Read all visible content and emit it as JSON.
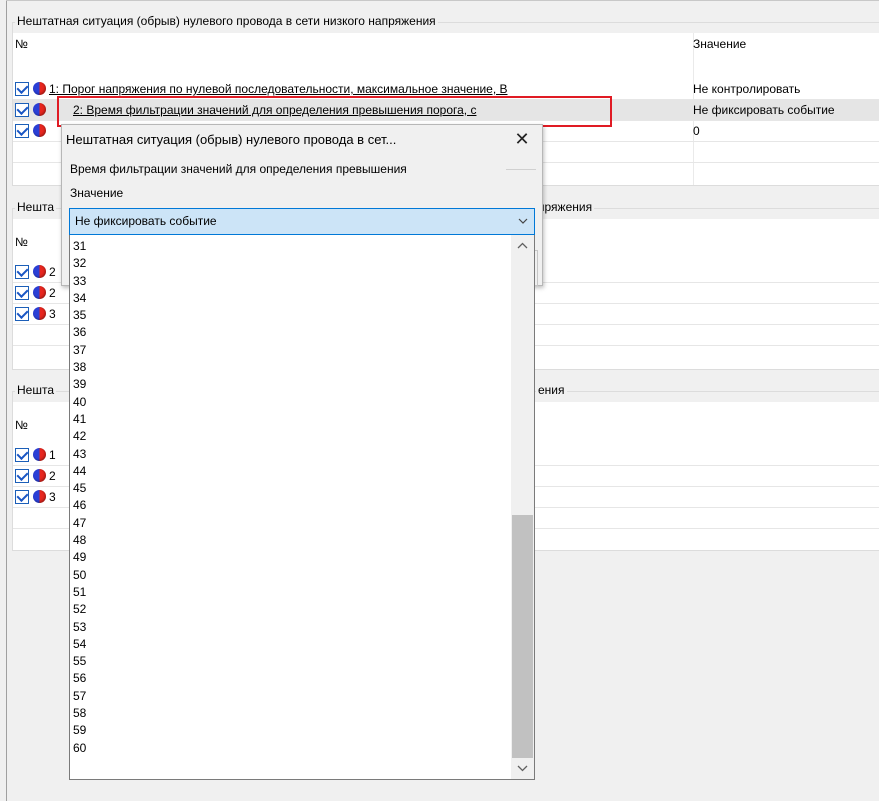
{
  "panels": [
    {
      "title": "Нештатная ситуация (обрыв) нулевого провода в сети низкого напряжения",
      "col_num": "№",
      "col_value": "Значение",
      "rows": [
        {
          "label": "1: Порог напряжения по нулевой последовательности, максимальное значение, В",
          "value": "Не контролировать"
        },
        {
          "label": "2: Время фильтрации значений для определения превышения порога, с",
          "value": "Не фиксировать событие"
        },
        {
          "label": "",
          "value": "0"
        }
      ]
    },
    {
      "title_start": "Нешта",
      "title_end": "пряжения",
      "col_num": "№",
      "rows": [
        {
          "prefix": "2"
        },
        {
          "prefix": "2"
        },
        {
          "prefix": "3"
        }
      ]
    },
    {
      "title_start": "Нешта",
      "title_end": "ения",
      "col_num": "№",
      "rows": [
        {
          "prefix": "1"
        },
        {
          "prefix": "2"
        },
        {
          "prefix": "3"
        }
      ]
    }
  ],
  "popup": {
    "title": "Нештатная ситуация (обрыв) нулевого провода в сет...",
    "close_glyph": "✕",
    "subtitle": "Время фильтрации значений для определения превышения",
    "field_label": "Значение",
    "selected": "Не фиксировать событие"
  },
  "dropdown": {
    "options": [
      "31",
      "32",
      "33",
      "34",
      "35",
      "36",
      "37",
      "38",
      "39",
      "40",
      "41",
      "42",
      "43",
      "44",
      "45",
      "46",
      "47",
      "48",
      "49",
      "50",
      "51",
      "52",
      "53",
      "54",
      "55",
      "56",
      "57",
      "58",
      "59",
      "60"
    ]
  },
  "icons": {
    "checkbox": "checkbox-checked-icon",
    "status": "red-blue-ball-icon",
    "close": "close-icon",
    "chevron": "chevron-down-icon"
  },
  "colors": {
    "highlight": "#e01b24",
    "combo_bg": "#cce4f7",
    "combo_border": "#0078d7",
    "scroll_thumb": "#c1c1c1"
  }
}
